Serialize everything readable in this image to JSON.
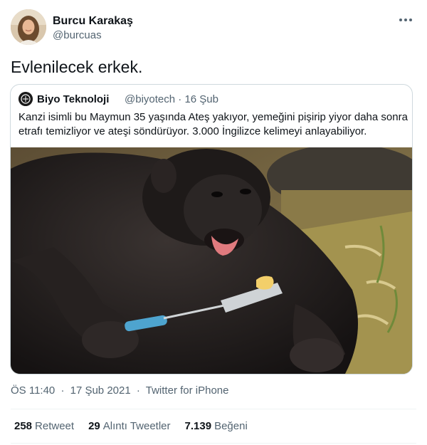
{
  "author": {
    "name": "Burcu Karakaş",
    "handle": "@burcuas"
  },
  "tweet": {
    "text": "Evlenilecek erkek."
  },
  "quoted": {
    "name": "Biyo Teknoloji",
    "handle": "@biyotech",
    "date": "16 Şub",
    "text": "Kanzi isimli bu Maymun 35 yaşında Ateş yakıyor, yemeğini pişirip yiyor daha sonra etrafı temizliyor ve ateşi söndürüyor. 3.000 İngilizce kelimeyi anlayabiliyor."
  },
  "meta": {
    "time": "ÖS 11:40",
    "date": "17 Şub 2021",
    "source": "Twitter for iPhone"
  },
  "stats": {
    "retweets_count": "258",
    "retweets_label": "Retweet",
    "quotes_count": "29",
    "quotes_label": "Alıntı Tweetler",
    "likes_count": "7.139",
    "likes_label": "Beğeni"
  },
  "colors": {
    "text_primary": "#0f1419",
    "text_secondary": "#536471",
    "border": "#cfd9de"
  }
}
